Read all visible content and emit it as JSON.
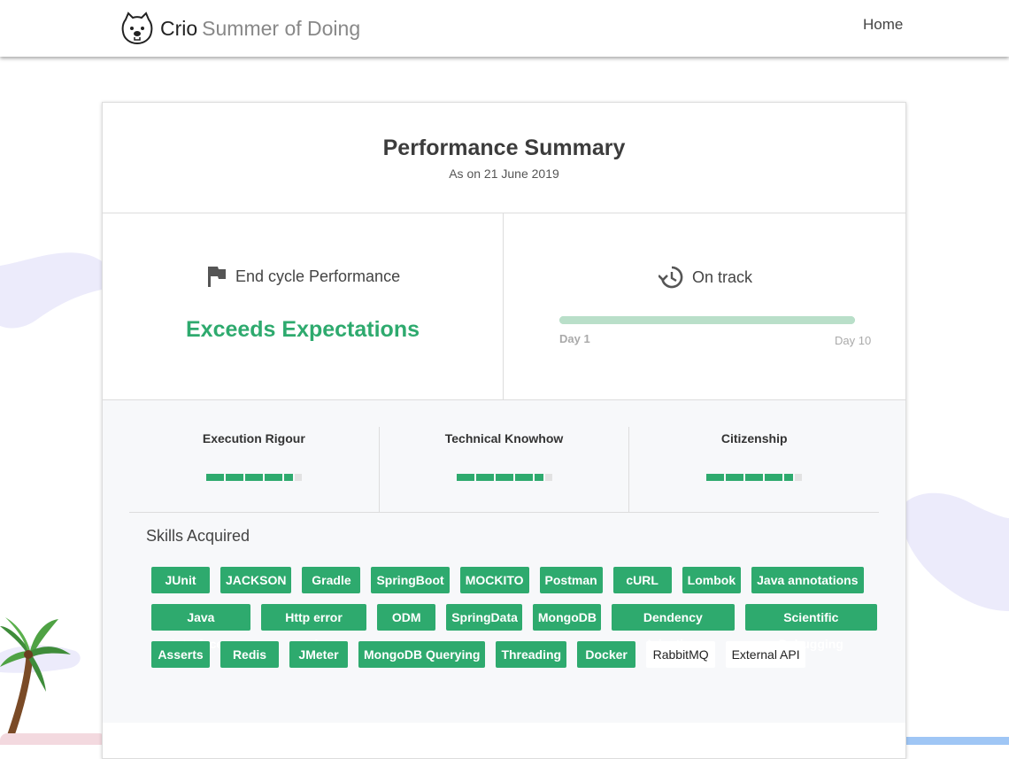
{
  "header": {
    "brand": "Crio",
    "tagline": "Summer of Doing",
    "nav_home": "Home"
  },
  "summary": {
    "title": "Performance Summary",
    "subtitle": "As on 21 June 2019",
    "end_cycle_label": "End cycle Performance",
    "end_cycle_value": "Exceeds Expectations",
    "track_label": "On track",
    "track_progress": 1.0,
    "day_start": "Day 1",
    "day_end": "Day 10"
  },
  "metrics": [
    {
      "name": "Execution Rigour",
      "level": 4.5,
      "max": 5
    },
    {
      "name": "Technical Knowhow",
      "level": 4.5,
      "max": 5
    },
    {
      "name": "Citizenship",
      "level": 4.5,
      "max": 5
    }
  ],
  "skills": {
    "title": "Skills Acquired",
    "rows": [
      [
        {
          "label": "JUnit",
          "w": 66
        },
        {
          "label": "JACKSON",
          "w": 75
        },
        {
          "label": "Gradle",
          "w": 66
        },
        {
          "label": "SpringBoot",
          "w": 80
        },
        {
          "label": "MOCKITO",
          "w": 75
        },
        {
          "label": "Postman",
          "w": 70
        },
        {
          "label": "cURL",
          "w": 66
        },
        {
          "label": "Lombok",
          "w": 66
        },
        {
          "label": "Java annotations",
          "w": 119
        }
      ],
      [
        {
          "label": "Java Interfaces",
          "w": 110
        },
        {
          "label": "Http error codes",
          "w": 114
        },
        {
          "label": "ODM",
          "w": 66
        },
        {
          "label": "SpringData",
          "w": 82
        },
        {
          "label": "MongoDB",
          "w": 73
        },
        {
          "label": "Dendency Injection",
          "w": 133
        },
        {
          "label": "Scientific Debugging",
          "w": 142
        }
      ],
      [
        {
          "label": "Asserts",
          "w": 66
        },
        {
          "label": "Redis",
          "w": 66
        },
        {
          "label": "JMeter",
          "w": 66
        },
        {
          "label": "MongoDB Querying",
          "w": 133
        },
        {
          "label": "Threading",
          "w": 76
        },
        {
          "label": "Docker",
          "w": 66
        },
        {
          "label": "RabbitMQ",
          "w": 78,
          "plain": true
        },
        {
          "label": "External API",
          "w": 90,
          "plain": true
        }
      ]
    ]
  },
  "colors": {
    "accent": "#2eaa6e",
    "track": "#b9dfc9",
    "bar_off": "#e2e2e2",
    "blob": "#ecebfb"
  }
}
